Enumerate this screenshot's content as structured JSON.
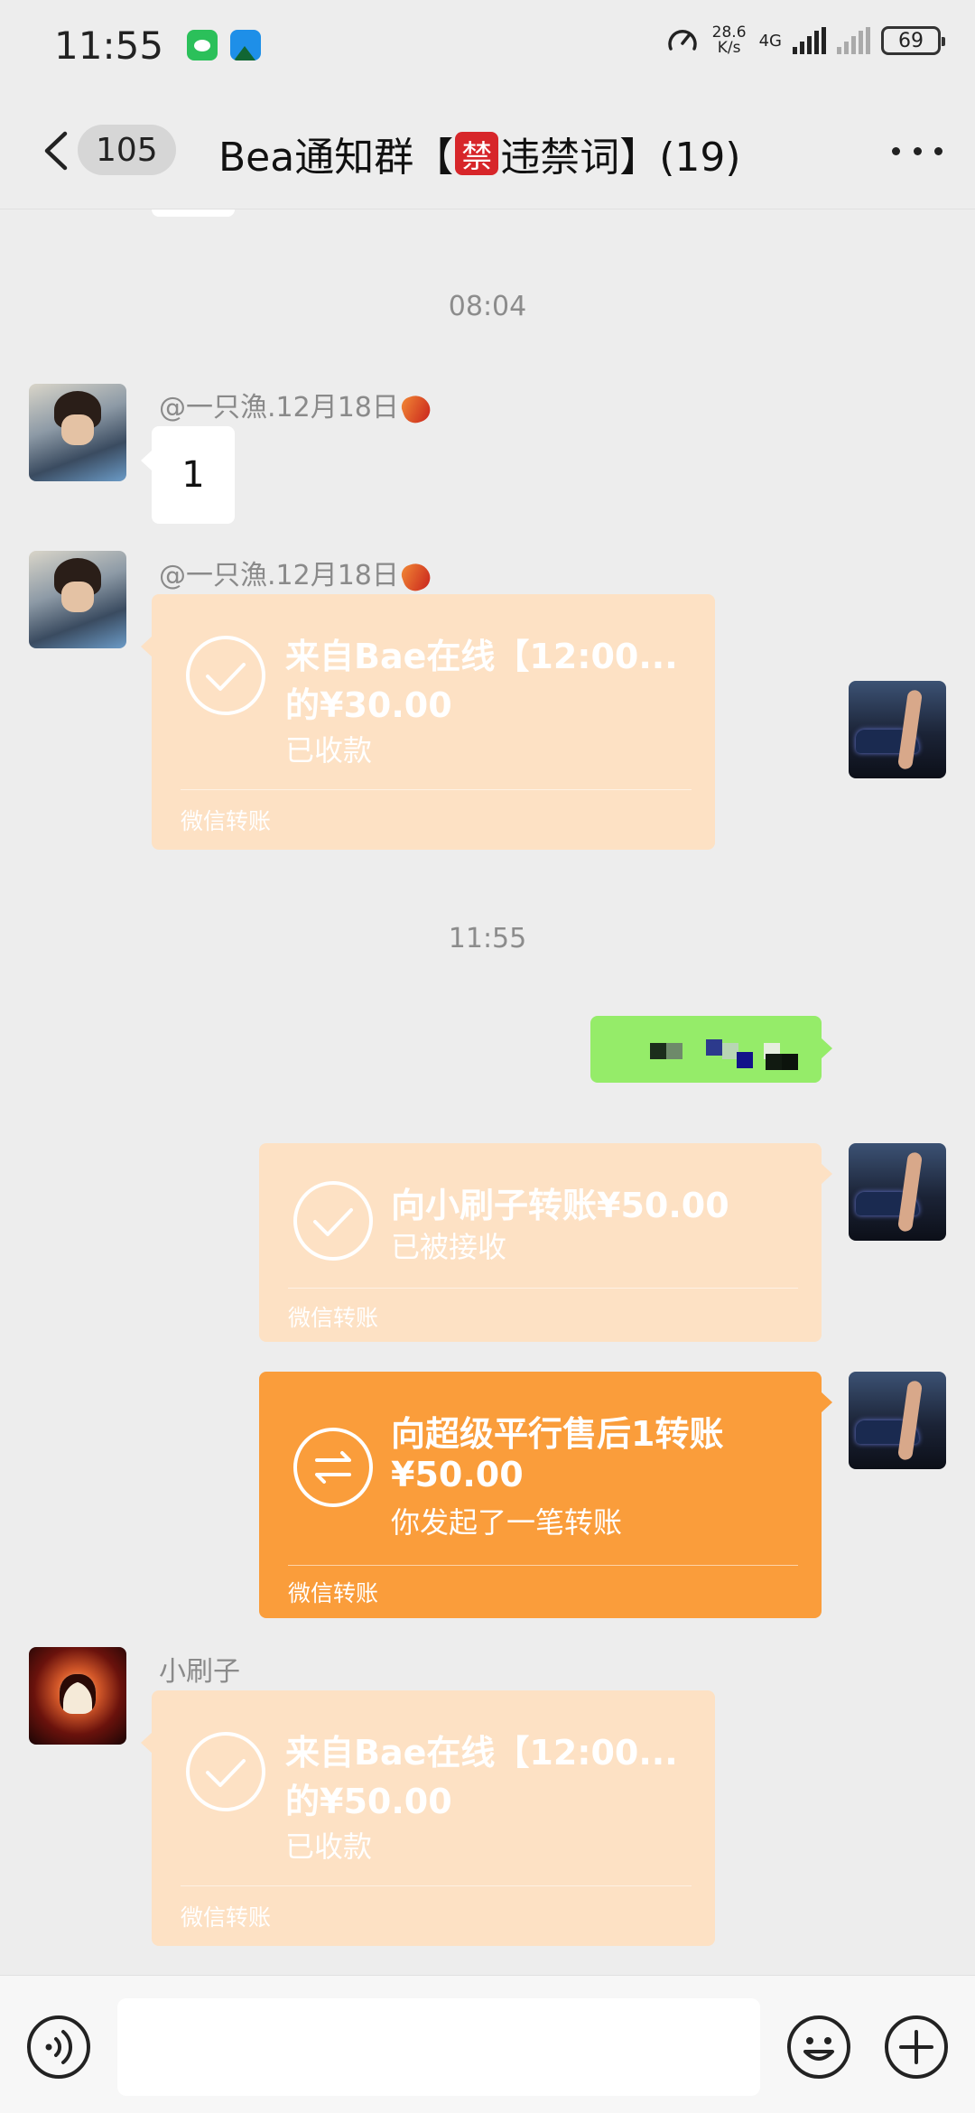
{
  "status_bar": {
    "time": "11:55",
    "net_speed_value": "28.6",
    "net_speed_unit": "K/s",
    "network_type": "4G",
    "battery": "69"
  },
  "header": {
    "unread_count": "105",
    "title_prefix": "Bea通知群【",
    "ban_char": "禁",
    "title_suffix": "违禁词】(19)"
  },
  "messages": {
    "time_1": "08:04",
    "msg1_sender": "@一只漁.12月18日",
    "msg1_text": "1",
    "msg2_sender": "@一只漁.12月18日",
    "msg2_title1": "来自Bae在线【12:00...",
    "msg2_title2": "的¥30.00",
    "msg2_status": "已收款",
    "msg2_footer": "微信转账",
    "time_2": "11:55",
    "msg4_title": "向小刷子转账¥50.00",
    "msg4_status": "已被接收",
    "msg4_footer": "微信转账",
    "msg5_title1": "向超级平行售后1转账",
    "msg5_title2": "¥50.00",
    "msg5_status": "你发起了一笔转账",
    "msg5_footer": "微信转账",
    "msg6_sender": "小刷子",
    "msg6_title1": "来自Bae在线【12:00...",
    "msg6_title2": "的¥50.00",
    "msg6_status": "已收款",
    "msg6_footer": "微信转账"
  },
  "icons": {
    "back": "chevron-left-icon",
    "more": "more-dots-icon",
    "voice": "voice-icon",
    "emoji": "emoji-icon",
    "plus": "plus-icon",
    "received": "check-circle-icon",
    "transfer": "transfer-arrows-icon"
  },
  "colors": {
    "background": "#ededed",
    "self_bubble": "#95ec69",
    "transfer_received": "#fde1c4",
    "transfer_pending": "#fa9d3b",
    "ban_badge": "#d7262a"
  }
}
